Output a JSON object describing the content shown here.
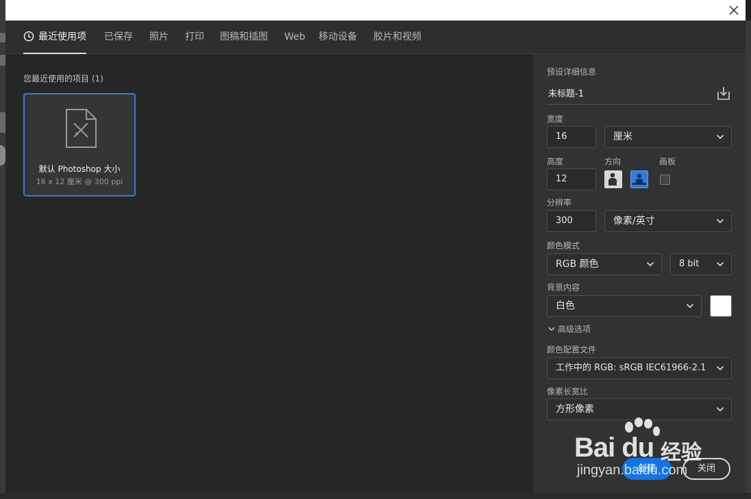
{
  "window": {
    "close_glyph": "×"
  },
  "tabs": [
    {
      "label": "最近使用项",
      "active": true
    },
    {
      "label": "已保存"
    },
    {
      "label": "照片"
    },
    {
      "label": "打印"
    },
    {
      "label": "图稿和插图"
    },
    {
      "label": "Web"
    },
    {
      "label": "移动设备"
    },
    {
      "label": "胶片和视频"
    }
  ],
  "recent": {
    "heading": "您最近使用的项目  (1)",
    "items": [
      {
        "title": "默认 Photoshop 大小",
        "subtitle": "16 x 12 厘米 @ 300 ppi",
        "icon": "document-pencil-icon"
      }
    ]
  },
  "preset_details": {
    "section_label": "预设详细信息",
    "name": "未标题-1",
    "width_label": "宽度",
    "width_value": "16",
    "width_unit": "厘米",
    "height_label": "高度",
    "height_value": "12",
    "orientation_label": "方向",
    "orientation_selected": "landscape",
    "artboard_label": "画板",
    "artboard_checked": false,
    "resolution_label": "分辨率",
    "resolution_value": "300",
    "resolution_unit": "像素/英寸",
    "color_mode_label": "颜色模式",
    "color_mode": "RGB 颜色",
    "bit_depth": "8 bit",
    "background_label": "背景内容",
    "background": "白色",
    "background_swatch": "#ffffff",
    "advanced_label": "高级选项",
    "color_profile_label": "颜色配置文件",
    "color_profile": "工作中的 RGB: sRGB IEC61966-2.1",
    "pixel_aspect_label": "像素长宽比",
    "pixel_aspect": "方形像素"
  },
  "buttons": {
    "create": "创建",
    "close": "关闭"
  },
  "watermark": {
    "brand": "Bai du",
    "brand_cn": "经验",
    "url": "jingyan.baidu.com"
  },
  "colors": {
    "accent": "#1473e6",
    "selection_border": "#2d7fd6",
    "panel_bg": "#323232",
    "main_bg": "#262626"
  }
}
